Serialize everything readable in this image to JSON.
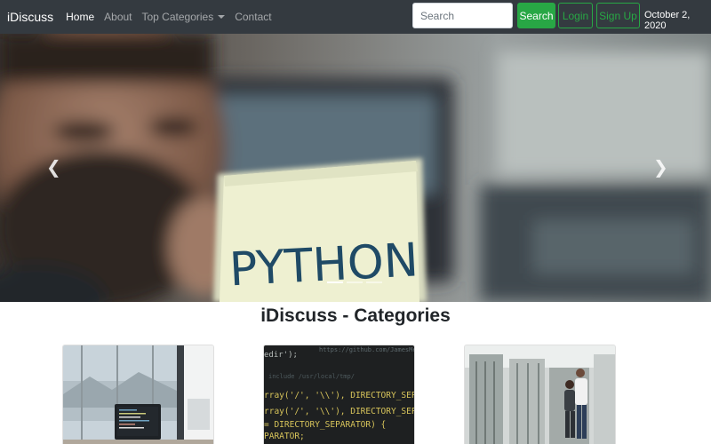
{
  "navbar": {
    "brand": "iDiscuss",
    "links": [
      {
        "label": "Home",
        "active": true
      },
      {
        "label": "About",
        "active": false
      },
      {
        "label": "Top Categories",
        "active": false,
        "dropdown": true
      },
      {
        "label": "Contact",
        "active": false
      }
    ],
    "search_placeholder": "Search",
    "search_button": "Search",
    "login_button": "Login",
    "signup_button": "Sign Up",
    "date": "October 2, 2020"
  },
  "carousel": {
    "slide_text": "PYTHON",
    "prev_icon": "chevron-left-icon",
    "next_icon": "chevron-right-icon",
    "indicator_count": 3,
    "active_index": 0
  },
  "categories": {
    "title": "iDiscuss - Categories",
    "code_lines": [
      "edir');",
      "rray('/', '\\\\'), DIRECTORY_SEPARAT",
      "rray('/', '\\\\'), DIRECTORY_SEPARAT",
      "= DIRECTORY_SEPARATOR) {",
      "PARATOR;"
    ]
  },
  "colors": {
    "navbar_bg": "#343a40",
    "success": "#28a745"
  }
}
